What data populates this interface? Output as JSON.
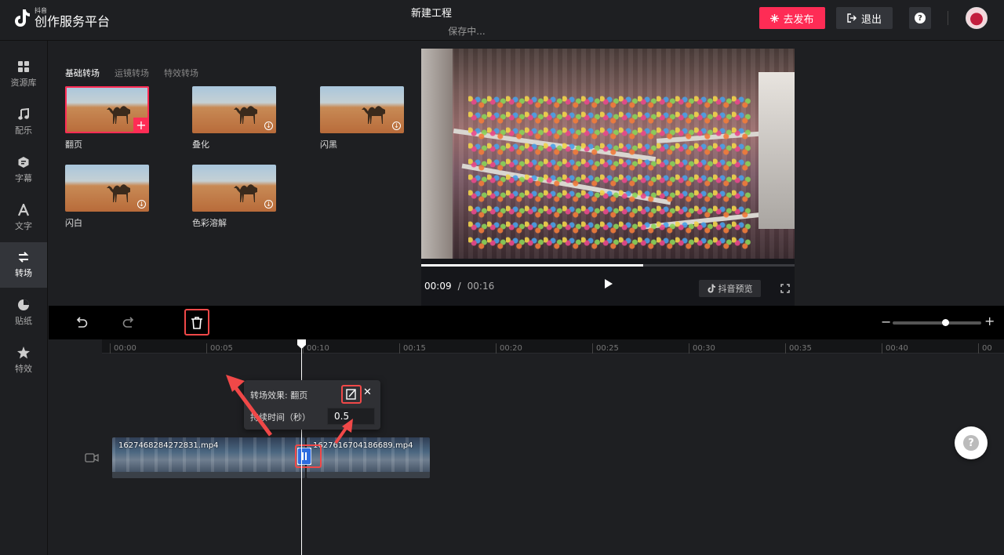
{
  "header": {
    "logo_small": "抖音",
    "logo_main": "创作服务平台",
    "project_title": "新建工程",
    "project_status": "保存中...",
    "publish_label": "去发布",
    "exit_label": "退出",
    "help_glyph": "?"
  },
  "sidebar": {
    "items": [
      {
        "label": "资源库",
        "icon": "grid-icon"
      },
      {
        "label": "配乐",
        "icon": "music-note-icon"
      },
      {
        "label": "字幕",
        "icon": "subtitle-icon"
      },
      {
        "label": "文字",
        "icon": "text-icon"
      },
      {
        "label": "转场",
        "icon": "transition-icon",
        "active": true
      },
      {
        "label": "贴纸",
        "icon": "sticker-icon"
      },
      {
        "label": "特效",
        "icon": "effects-star-icon"
      }
    ]
  },
  "panel": {
    "tabs": [
      {
        "label": "基础转场",
        "active": true
      },
      {
        "label": "运镜转场"
      },
      {
        "label": "特效转场"
      }
    ],
    "tiles": [
      {
        "label": "翻页",
        "selected": true
      },
      {
        "label": "叠化"
      },
      {
        "label": "闪黑"
      },
      {
        "label": "闪白"
      },
      {
        "label": "色彩溶解"
      }
    ]
  },
  "preview": {
    "current_time": "00:09",
    "separator": "/",
    "total_time": "00:16",
    "progress": 0.595,
    "douyin_preview_label": "抖音预览"
  },
  "timeline": {
    "ticks": [
      "00:00",
      "00:05",
      "00:10",
      "00:15",
      "00:20",
      "00:25",
      "00:30",
      "00:35",
      "00:40",
      "00"
    ],
    "clips": [
      {
        "name": "1627468284272831.mp4"
      },
      {
        "name": "1627616704186689.mp4"
      }
    ],
    "zoom_level": 0.6
  },
  "popover": {
    "title": "转场效果: 翻页",
    "duration_label": "持续时间（秒）",
    "duration_value": "0.5",
    "close_glyph": "✕"
  },
  "colors": {
    "accent": "#fe2c55",
    "highlight": "#f04848",
    "background": "#1e1f22"
  }
}
